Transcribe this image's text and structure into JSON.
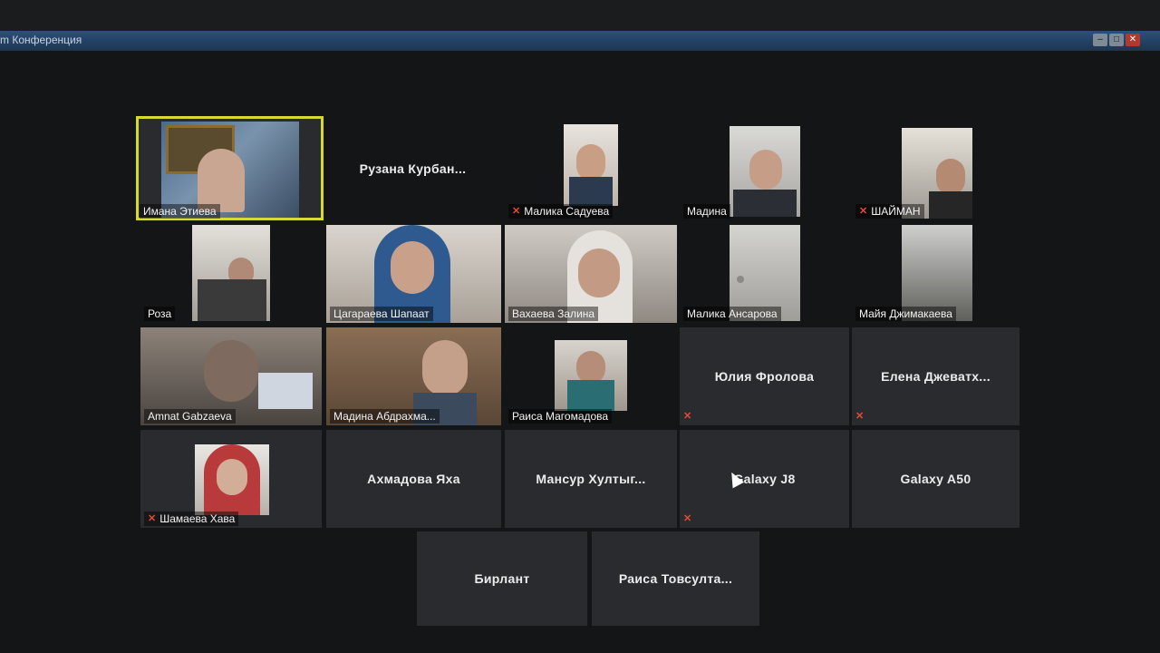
{
  "window": {
    "title": "m Конференция",
    "buttons": [
      "–",
      "□",
      "✕"
    ]
  },
  "participants": [
    {
      "name": "Имана Этиева",
      "video": true,
      "active": true
    },
    {
      "name": "Рузана  Курбан...",
      "video": false
    },
    {
      "name": "Малика Садуева",
      "video": true,
      "muted": true
    },
    {
      "name": "Мадина",
      "video": true
    },
    {
      "name": "ШАЙМАН",
      "video": true,
      "muted": true
    },
    {
      "name": "Роза",
      "video": true
    },
    {
      "name": "Цагараева Шапаат",
      "video": true
    },
    {
      "name": "Вахаева Залина",
      "video": true
    },
    {
      "name": "Малика Ансарова",
      "video": true
    },
    {
      "name": "Майя Джимакаева",
      "video": true
    },
    {
      "name": "Amnat Gabzaeva",
      "video": true
    },
    {
      "name": "Мадина Абдрахма...",
      "video": true
    },
    {
      "name": "Раиса Магомадова",
      "video": true
    },
    {
      "name": "Юлия Фролова",
      "video": false,
      "muted": true
    },
    {
      "name": "Елена  Джеватх...",
      "video": false,
      "muted": true
    },
    {
      "name": "Шамаева Хава",
      "video": true,
      "muted": true
    },
    {
      "name": "Ахмадова Яха",
      "video": false
    },
    {
      "name": "Мансур  Хултыг...",
      "video": false
    },
    {
      "name": "Galaxy J8",
      "video": false,
      "muted": true
    },
    {
      "name": "Galaxy A50",
      "video": false
    },
    {
      "name": "Бирлант",
      "video": false
    },
    {
      "name": "Раиса  Товсулта...",
      "video": false
    }
  ],
  "colors": {
    "active_speaker": "#d6d930",
    "muted_icon": "#e04b3c",
    "tile_bg": "#2a2b2e"
  },
  "icons": {
    "muted": "microphone-muted-icon"
  }
}
